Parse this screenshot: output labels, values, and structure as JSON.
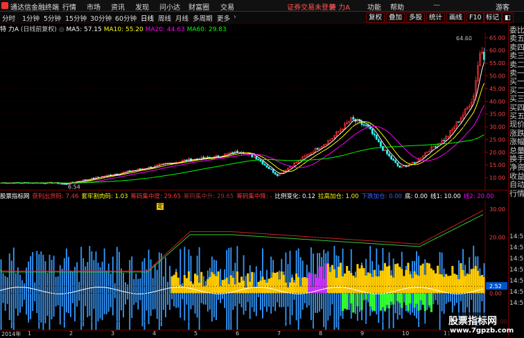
{
  "menubar": {
    "app_name": "通达信金融终端",
    "items": [
      "行情",
      "市场",
      "资讯",
      "发现",
      "问小达",
      "财富圈",
      "交易"
    ],
    "login_status": "证券交易未登录",
    "stock_short": "特 力A",
    "right_items": [
      "功能",
      "帮助",
      "游客"
    ]
  },
  "periodbar": {
    "periods": [
      "分时",
      "1分钟",
      "5分钟",
      "15分钟",
      "30分钟",
      "60分钟",
      "日线",
      "周线",
      "月线",
      "多周期",
      "更多"
    ],
    "active_period": "日线",
    "tools": [
      "复权",
      "叠加",
      "多股",
      "统计",
      "画线",
      "F10",
      "标记"
    ],
    "tool_icon": "◧"
  },
  "chart_title": {
    "name": "特 力A",
    "mode": "(日线前复权)",
    "ma5": "MA5: 57.15",
    "ma10": "MA10: 55.20",
    "ma20": "MA20: 44.63",
    "ma60": "MA60: 29.83",
    "ma5_color": "#ffffff",
    "ma10_color": "#ffff00",
    "ma20_color": "#ff00ff",
    "ma60_color": "#00ff00"
  },
  "price_axis": [
    "65.00",
    "60.00",
    "55.00",
    "50.00",
    "45.00",
    "40.00",
    "35.00",
    "30.00",
    "25.00",
    "20.00",
    "15.00",
    "10.00"
  ],
  "price_labels": {
    "high": "64.60",
    "low": "6.54"
  },
  "indicator_axis": [
    "30.00",
    "20.00",
    "2.52",
    "0.00",
    "-10.00"
  ],
  "indicator_row": {
    "name": "股票指标网",
    "items": [
      {
        "label": "获利出货码: 7.46",
        "color": "#ff3333"
      },
      {
        "label": "套牢割肉码: 1.03",
        "color": "#ffff00"
      },
      {
        "label": "筹码集中度: 29.65",
        "color": "#ff3333"
      },
      {
        "label": "筹码集中升: 29.65",
        "color": "#993333"
      },
      {
        "label": "筹码集中降: -",
        "color": "#ff3333"
      },
      {
        "label": "比例变化: 0.12",
        "color": "#ffffff"
      },
      {
        "label": "拉高加仓: 1.00",
        "color": "#ffff00"
      },
      {
        "label": "下跌加仓: 0.00",
        "color": "#3366ff"
      },
      {
        "label": "底: 0.00",
        "color": "#ffffff"
      },
      {
        "label": "线1: 10.00",
        "color": "#ffffff"
      },
      {
        "label": "线2: 20.00",
        "color": "#ff00ff"
      }
    ]
  },
  "right_panel": {
    "items": [
      "委比",
      "卖五",
      "卖四",
      "卖三",
      "卖二",
      "卖一",
      "买一",
      "买二",
      "买三",
      "买四",
      "买五",
      "现价",
      "涨跌",
      "涨幅",
      "总量",
      "换手",
      "净资",
      "收益",
      "自动",
      "行情"
    ],
    "ticks": [
      "14:56",
      "14:56",
      "14:56",
      "14:56",
      "14:56",
      "14:56",
      "14:56"
    ]
  },
  "date_axis": [
    "2014年",
    "1",
    "2",
    "3",
    "4",
    "5",
    "6",
    "7",
    "8",
    "9",
    "10",
    "11"
  ],
  "marker": "定",
  "watermark": {
    "title": "股票指标网",
    "url": "www.7gpzb.com"
  }
}
